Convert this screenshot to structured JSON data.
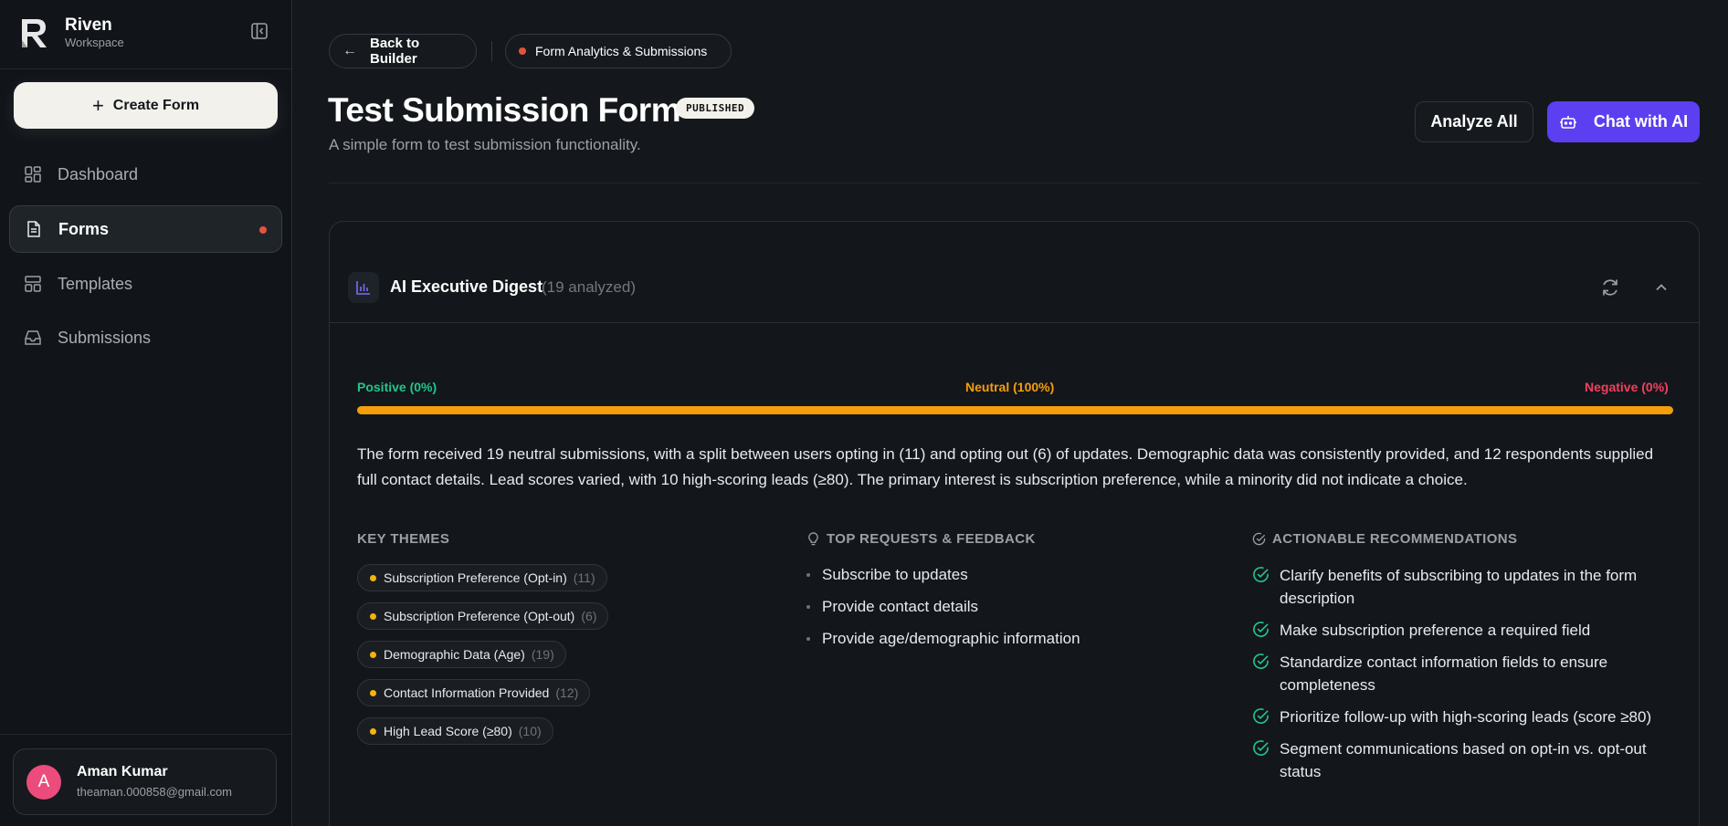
{
  "brand": {
    "name": "Riven",
    "sub": "Workspace"
  },
  "sidebar": {
    "create_label": "Create Form",
    "items": [
      {
        "label": "Dashboard",
        "icon": "dashboard-icon"
      },
      {
        "label": "Forms",
        "icon": "file-icon",
        "active": true
      },
      {
        "label": "Templates",
        "icon": "templates-icon"
      },
      {
        "label": "Submissions",
        "icon": "inbox-icon"
      }
    ]
  },
  "user": {
    "initial": "A",
    "name": "Aman Kumar",
    "email": "theaman.000858@gmail.com"
  },
  "topbar": {
    "back_label": "Back to Builder",
    "section_label": "Form Analytics & Submissions"
  },
  "header": {
    "title": "Test Submission Form",
    "badge": "PUBLISHED",
    "subtitle": "A simple form to test submission functionality.",
    "analyze_label": "Analyze All",
    "chat_label": "Chat with AI"
  },
  "digest": {
    "title": "AI Executive Digest",
    "count": "(19 analyzed)",
    "sentiment": {
      "positive_label": "Positive (0%)",
      "neutral_label": "Neutral (100%)",
      "negative_label": "Negative (0%)",
      "positive": 0,
      "neutral": 100,
      "negative": 0
    },
    "summary": "The form received 19 neutral submissions, with a split between users opting in (11) and opting out (6) of updates. Demographic data was consistently provided, and 12 respondents supplied full contact details. Lead scores varied, with 10 high-scoring leads (≥80). The primary interest is subscription preference, while a minority did not indicate a choice.",
    "themes_heading": "KEY THEMES",
    "themes": [
      {
        "label": "Subscription Preference (Opt-in)",
        "count": "(11)"
      },
      {
        "label": "Subscription Preference (Opt-out)",
        "count": "(6)"
      },
      {
        "label": "Demographic Data (Age)",
        "count": "(19)"
      },
      {
        "label": "Contact Information Provided",
        "count": "(12)"
      },
      {
        "label": "High Lead Score (≥80)",
        "count": "(10)"
      }
    ],
    "requests_heading": "TOP REQUESTS & FEEDBACK",
    "requests": [
      "Subscribe to updates",
      "Provide contact details",
      "Provide age/demographic information"
    ],
    "recs_heading": "ACTIONABLE RECOMMENDATIONS",
    "recommendations": [
      "Clarify benefits of subscribing to updates in the form description",
      "Make subscription preference a required field",
      "Standardize contact information fields to ensure completeness",
      "Prioritize follow-up with high-scoring leads (score ≥80)",
      "Segment communications based on opt-in vs. opt-out status"
    ]
  },
  "colors": {
    "accent": "#5b3ff1",
    "positive": "#22c58b",
    "neutral": "#f59e0b",
    "negative": "#f43f5e"
  }
}
